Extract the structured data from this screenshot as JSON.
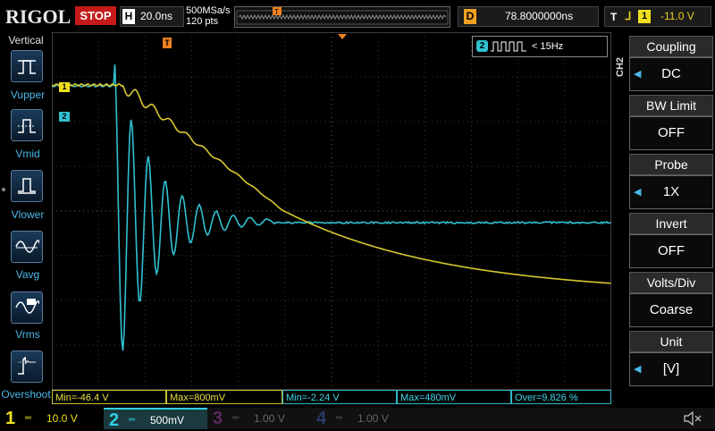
{
  "topbar": {
    "logo": "RIGOL",
    "status": "STOP",
    "timebase_prefix": "H",
    "timebase": "20.0ns",
    "sample_rate": "500MSa/s",
    "points": "120 pts",
    "delay_prefix": "D",
    "delay": "78.8000000ns",
    "trigger_prefix": "T",
    "trigger_source": "1",
    "trigger_level": "-11.0 V"
  },
  "left_panel": {
    "title": "Vertical",
    "items": [
      {
        "label": "Vupper",
        "icon": "vupper-icon"
      },
      {
        "label": "Vmid",
        "icon": "vmid-icon"
      },
      {
        "label": "Vlower",
        "icon": "vlower-icon"
      },
      {
        "label": "Vavg",
        "icon": "vavg-icon"
      },
      {
        "label": "Vrms",
        "icon": "vrms-icon"
      },
      {
        "label": "Overshoot",
        "icon": "overshoot-icon"
      }
    ]
  },
  "right_panel": {
    "channel": "CH2",
    "items": [
      {
        "header": "Coupling",
        "value": "DC"
      },
      {
        "header": "BW Limit",
        "value": "OFF"
      },
      {
        "header": "Probe",
        "value": "1X"
      },
      {
        "header": "Invert",
        "value": "OFF"
      },
      {
        "header": "Volts/Div",
        "value": "Coarse"
      },
      {
        "header": "Unit",
        "value": "[V]"
      }
    ]
  },
  "markers": {
    "ch1": "1",
    "ch2": "2",
    "trigger": "T",
    "freq_channel": "2",
    "frequency": "< 15Hz"
  },
  "measurements": [
    {
      "text": "Min=-46.4 V",
      "color": "yellow"
    },
    {
      "text": "Max=800mV",
      "color": "yellow"
    },
    {
      "text": "Min=-2.24 V",
      "color": "cyan"
    },
    {
      "text": "Max=480mV",
      "color": "cyan"
    },
    {
      "text": "Over=9.826 %",
      "color": "cyan"
    }
  ],
  "channels": [
    {
      "num": "1",
      "scale": "10.0 V",
      "color": "#f0e020",
      "active": true
    },
    {
      "num": "2",
      "scale": "500mV",
      "color": "#30d0e0",
      "active": true
    },
    {
      "num": "3",
      "scale": "1.00 V",
      "color": "#c040c0",
      "active": false
    },
    {
      "num": "4",
      "scale": "1.00 V",
      "color": "#4060e0",
      "active": false
    }
  ],
  "colors": {
    "ch1": "#d8c830",
    "ch2": "#30c0d0",
    "grid": "#555555",
    "accent": "#f08020"
  }
}
